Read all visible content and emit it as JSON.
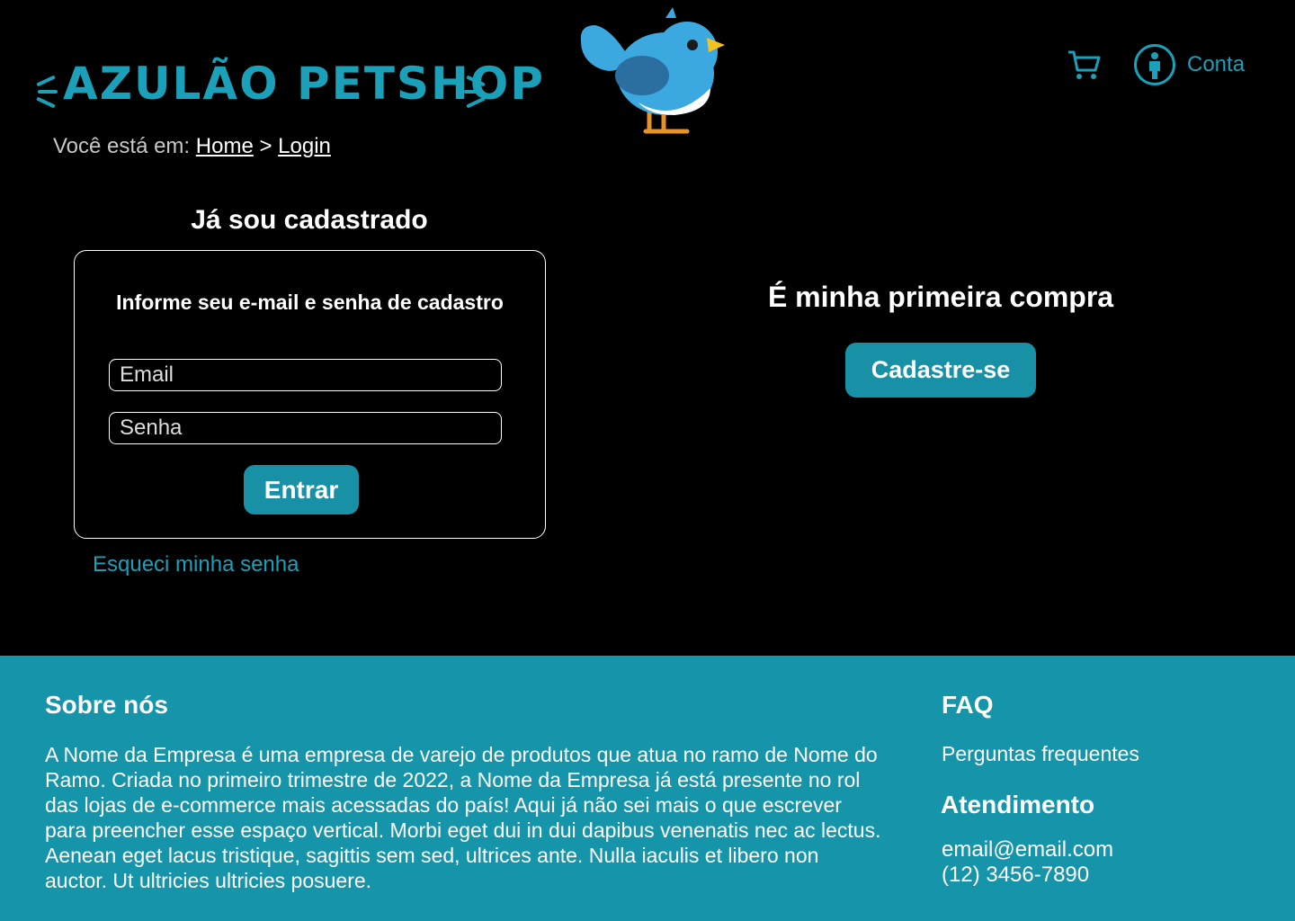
{
  "header": {
    "logo_text": "AZULÃO PETSHOP",
    "account_label": "Conta",
    "colors": {
      "accent": "#1aa0b8",
      "bird_blue": "#3ba9e0"
    },
    "icons": {
      "cart": "cart-icon",
      "account": "account-icon",
      "mascot": "bird-mascot-icon"
    }
  },
  "breadcrumb": {
    "prefix": "Você está em:",
    "home": "Home",
    "separator": ">",
    "current": "Login"
  },
  "login": {
    "title": "Já sou cadastrado",
    "subtitle": "Informe seu e-mail e senha de cadastro",
    "email_placeholder": "Email",
    "password_placeholder": "Senha",
    "submit_label": "Entrar",
    "forgot_label": "Esqueci minha senha"
  },
  "register": {
    "title": "É minha primeira compra",
    "button_label": "Cadastre-se"
  },
  "footer": {
    "about_title": "Sobre nós",
    "about_text": "A Nome da Empresa é uma empresa de varejo de produtos que atua no ramo de Nome do Ramo. Criada no primeiro trimestre de 2022, a Nome da Empresa já está presente no rol das  lojas de e-commerce mais acessadas do país! Aqui já não sei mais o que escrever para preencher esse espaço vertical. Morbi eget dui in dui dapibus venenatis nec ac lectus. Aenean eget lacus tristique, sagittis sem sed, ultrices ante. Nulla iaculis et libero non auctor. Ut ultricies ultricies posuere.",
    "faq_title": "FAQ",
    "faq_link": "Perguntas frequentes",
    "contact_title": "Atendimento",
    "contact_email": "email@email.com",
    "contact_phone": "(12) 3456-7890",
    "background": "#1694a9"
  }
}
